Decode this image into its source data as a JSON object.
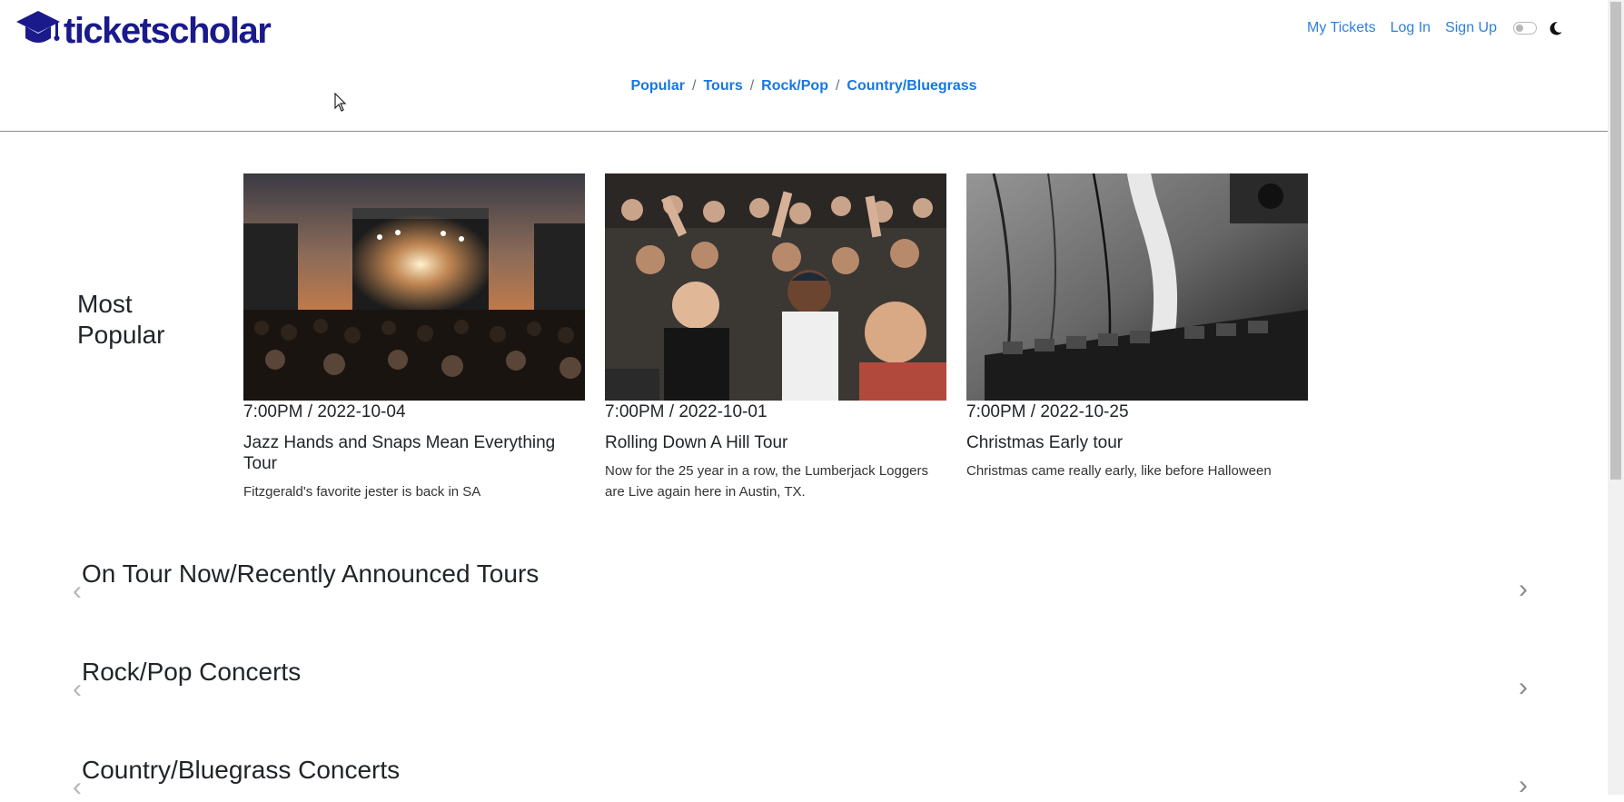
{
  "brand": {
    "name": "ticketscholar",
    "color": "#1a1a8c"
  },
  "topnav": {
    "my_tickets": "My Tickets",
    "log_in": "Log In",
    "sign_up": "Sign Up"
  },
  "breadcrumb": {
    "items": [
      "Popular",
      "Tours",
      "Rock/Pop",
      "Country/Bluegrass"
    ],
    "separator": "/"
  },
  "most_popular": {
    "heading": "Most Popular",
    "cards": [
      {
        "date": "7:00PM / 2022-10-04",
        "title": "Jazz Hands and Snaps Mean Everything Tour",
        "description": "Fitzgerald's favorite jester is back in SA",
        "image": "concert-stage-photo"
      },
      {
        "date": "7:00PM / 2022-10-01",
        "title": "Rolling Down A Hill Tour",
        "description": "Now for the 25 year in a row, the Lumberjack Loggers are Live again here in Austin, TX.",
        "image": "cheering-crowd-photo"
      },
      {
        "date": "7:00PM / 2022-10-25",
        "title": "Christmas Early tour",
        "description": "Christmas came really early, like before Halloween",
        "image": "audio-mixer-photo"
      }
    ]
  },
  "sections": [
    {
      "title": "On Tour Now/Recently Announced Tours"
    },
    {
      "title": "Rock/Pop Concerts"
    },
    {
      "title": "Country/Bluegrass Concerts"
    }
  ],
  "colors": {
    "link": "#2f7fd8",
    "breadcrumb_link": "#1877e0",
    "divider": "#8a8a8a"
  }
}
